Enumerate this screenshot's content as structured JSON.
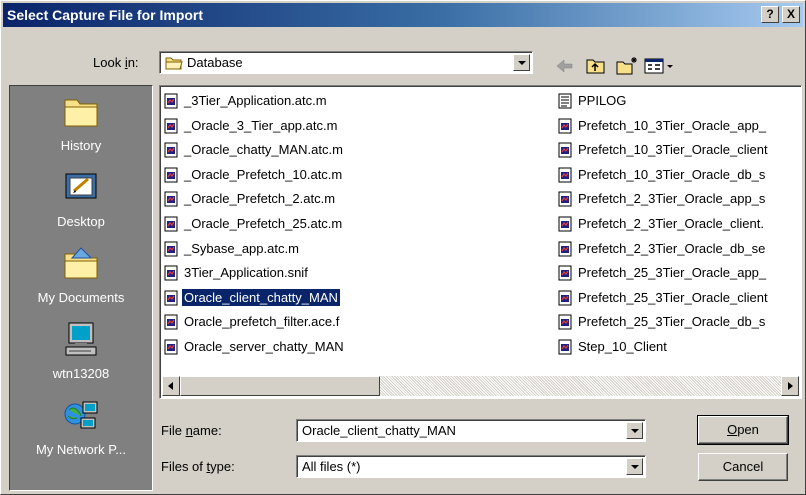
{
  "window": {
    "title": "Select Capture File for Import",
    "help_glyph": "?",
    "close_glyph": "X"
  },
  "look_in": {
    "label_pre": "Look ",
    "label_key": "i",
    "label_post": "n:",
    "value": "Database"
  },
  "toolbar": {
    "back_icon": "back-arrow-icon",
    "up_icon": "up-folder-icon",
    "new_folder_icon": "new-folder-icon",
    "views_icon": "views-menu-icon"
  },
  "places": [
    {
      "label": "History",
      "icon": "history-folder-icon"
    },
    {
      "label": "Desktop",
      "icon": "desktop-icon"
    },
    {
      "label": "My Documents",
      "icon": "my-documents-icon"
    },
    {
      "label": "wtn13208",
      "icon": "computer-icon"
    },
    {
      "label": "My Network P...",
      "icon": "network-places-icon"
    }
  ],
  "files_left": [
    "_3Tier_Application.atc.m",
    "_Oracle_3_Tier_app.atc.m",
    "_Oracle_chatty_MAN.atc.m",
    "_Oracle_Prefetch_10.atc.m",
    "_Oracle_Prefetch_2.atc.m",
    "_Oracle_Prefetch_25.atc.m",
    "_Sybase_app.atc.m",
    "3Tier_Application.snif",
    "Oracle_client_chatty_MAN",
    "Oracle_prefetch_filter.ace.f",
    "Oracle_server_chatty_MAN"
  ],
  "files_right": [
    "PPILOG",
    "Prefetch_10_3Tier_Oracle_app_",
    "Prefetch_10_3Tier_Oracle_client",
    "Prefetch_10_3Tier_Oracle_db_s",
    "Prefetch_2_3Tier_Oracle_app_s",
    "Prefetch_2_3Tier_Oracle_client.",
    "Prefetch_2_3Tier_Oracle_db_se",
    "Prefetch_25_3Tier_Oracle_app_",
    "Prefetch_25_3Tier_Oracle_client",
    "Prefetch_25_3Tier_Oracle_db_s",
    "Step_10_Client"
  ],
  "selected_file": "Oracle_client_chatty_MAN",
  "file_name": {
    "label_pre": "File ",
    "label_key": "n",
    "label_post": "ame:",
    "value": "Oracle_client_chatty_MAN"
  },
  "file_type": {
    "label_pre": "Files of ",
    "label_key": "t",
    "label_post": "ype:",
    "value": "All files (*)"
  },
  "buttons": {
    "open_key": "O",
    "open_rest": "pen",
    "cancel": "Cancel"
  },
  "colors": {
    "title_bar": "#0a246a",
    "selection": "#0a246a",
    "face": "#d4d0c8",
    "places_bar": "#808080"
  }
}
